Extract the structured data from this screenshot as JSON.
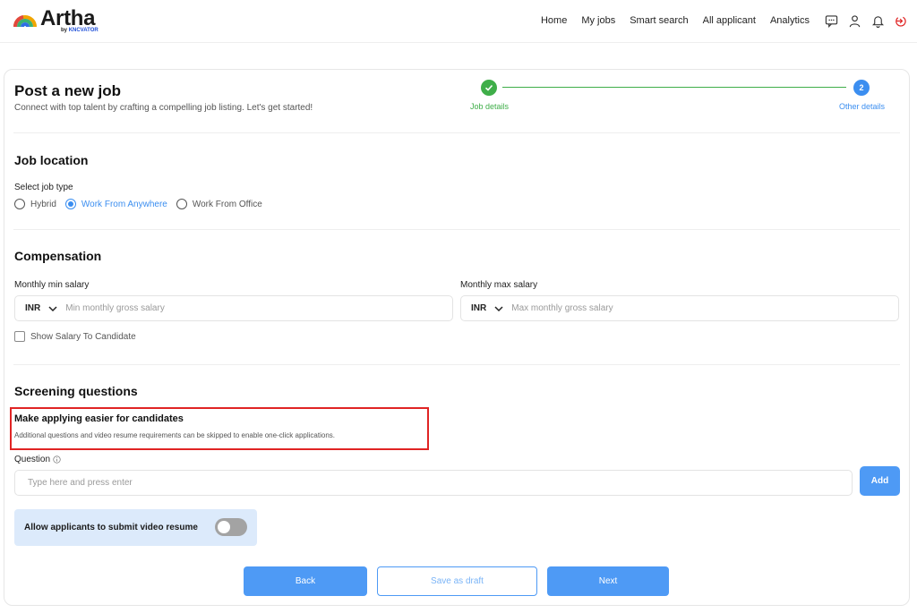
{
  "brand": {
    "name": "Artha",
    "by": "by",
    "by_brand": "KNCVATOR"
  },
  "nav": {
    "links": [
      "Home",
      "My jobs",
      "Smart search",
      "All applicant",
      "Analytics"
    ],
    "icons": [
      "chat-icon",
      "user-icon",
      "bell-icon",
      "logout-icon"
    ]
  },
  "header": {
    "title": "Post a new job",
    "subtitle": "Connect with top talent by crafting a compelling job listing. Let's get started!"
  },
  "stepper": {
    "steps": [
      {
        "label": "Job details",
        "status": "complete",
        "number": ""
      },
      {
        "label": "Other details",
        "status": "active",
        "number": "2"
      }
    ],
    "colors": {
      "complete": "#3fae49",
      "active": "#3b8ef0"
    }
  },
  "job_location": {
    "heading": "Job location",
    "type_label": "Select job type",
    "options": [
      "Hybrid",
      "Work From Anywhere",
      "Work From Office"
    ],
    "selected": "Work From Anywhere"
  },
  "compensation": {
    "heading": "Compensation",
    "min": {
      "label": "Monthly min salary",
      "currency": "INR",
      "placeholder": "Min monthly gross salary"
    },
    "max": {
      "label": "Monthly max salary",
      "currency": "INR",
      "placeholder": "Max monthly gross salary"
    },
    "show_salary_label": "Show Salary To Candidate",
    "show_salary_checked": false
  },
  "screening": {
    "heading": "Screening questions",
    "easy_apply_title": "Make applying easier for candidates",
    "easy_apply_desc": "Additional questions and video resume requirements can be skipped to enable one-click applications.",
    "question_label": "Question",
    "question_placeholder": "Type here and press enter",
    "add_label": "Add",
    "video_label": "Allow applicants to submit video resume",
    "video_enabled": false
  },
  "footer": {
    "back_label": "Back",
    "draft_label": "Save as draft",
    "next_label": "Next"
  },
  "colors": {
    "accent": "#4e9af5",
    "success": "#3fae49",
    "highlight_border": "#e02424"
  }
}
